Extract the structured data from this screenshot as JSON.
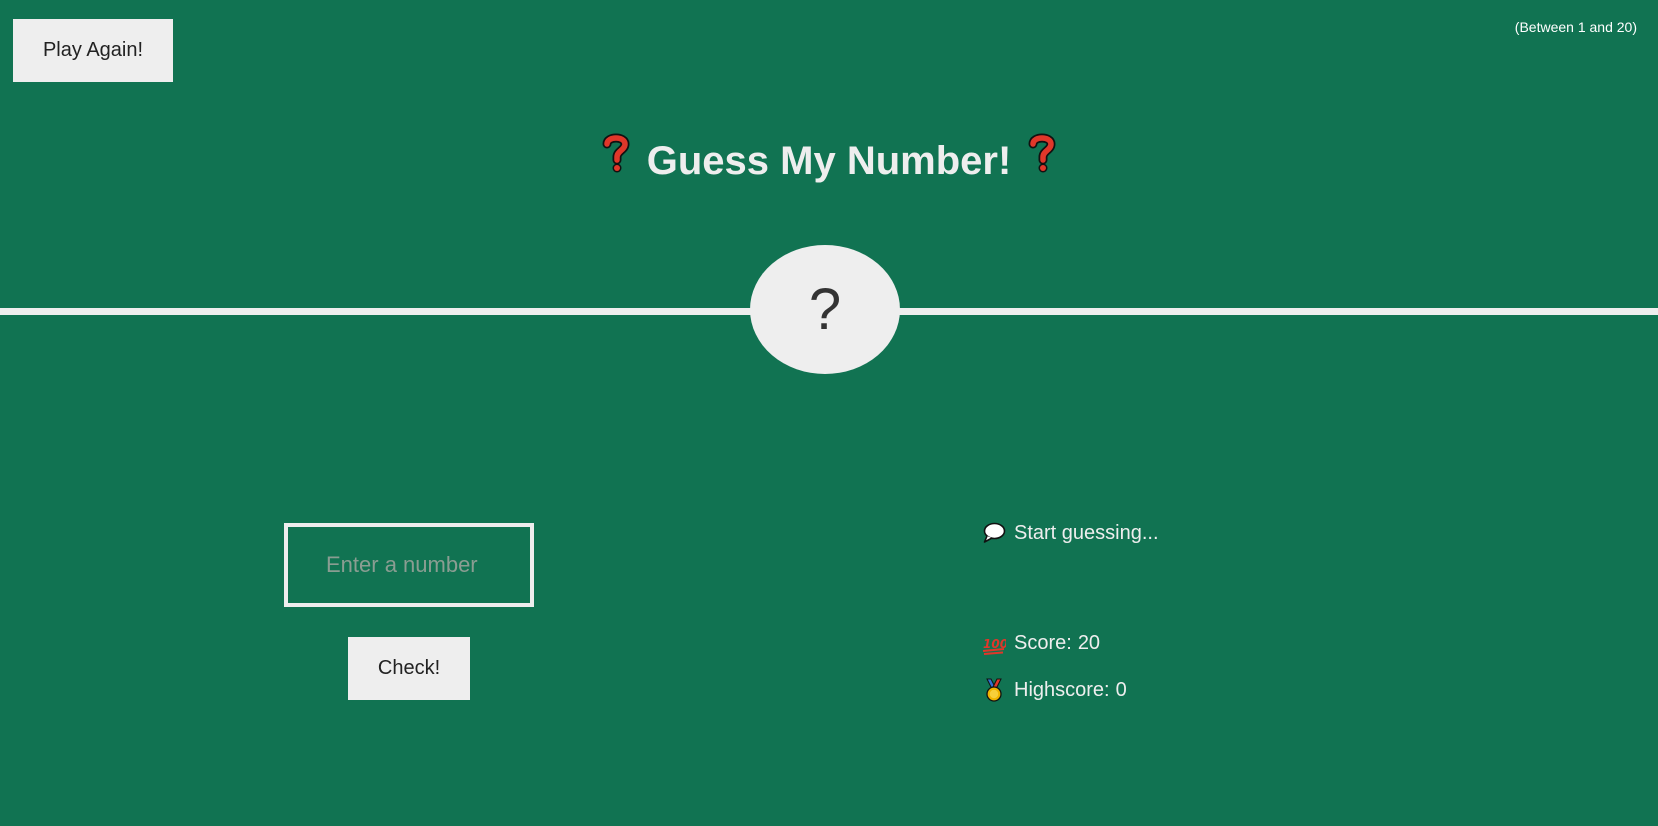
{
  "header": {
    "again_label": "Play Again!",
    "range_text": "(Between 1 and 20)",
    "title": "Guess My Number!"
  },
  "secret": {
    "display": "?"
  },
  "controls": {
    "input_placeholder": "Enter a number",
    "input_value": "",
    "check_label": "Check!"
  },
  "status": {
    "message": "Start guessing...",
    "score_label": "Score:",
    "score_value": "20",
    "highscore_label": "Highscore:",
    "highscore_value": "0"
  },
  "icons": {
    "title_left": "question-mark-icon",
    "title_right": "question-mark-icon",
    "message": "speech-bubble-icon",
    "score": "hundred-points-icon",
    "highscore": "medal-icon"
  },
  "colors": {
    "background": "#117352",
    "foreground": "#eeeeee",
    "button_text": "#222222",
    "emoji_red": "#e0372a"
  }
}
